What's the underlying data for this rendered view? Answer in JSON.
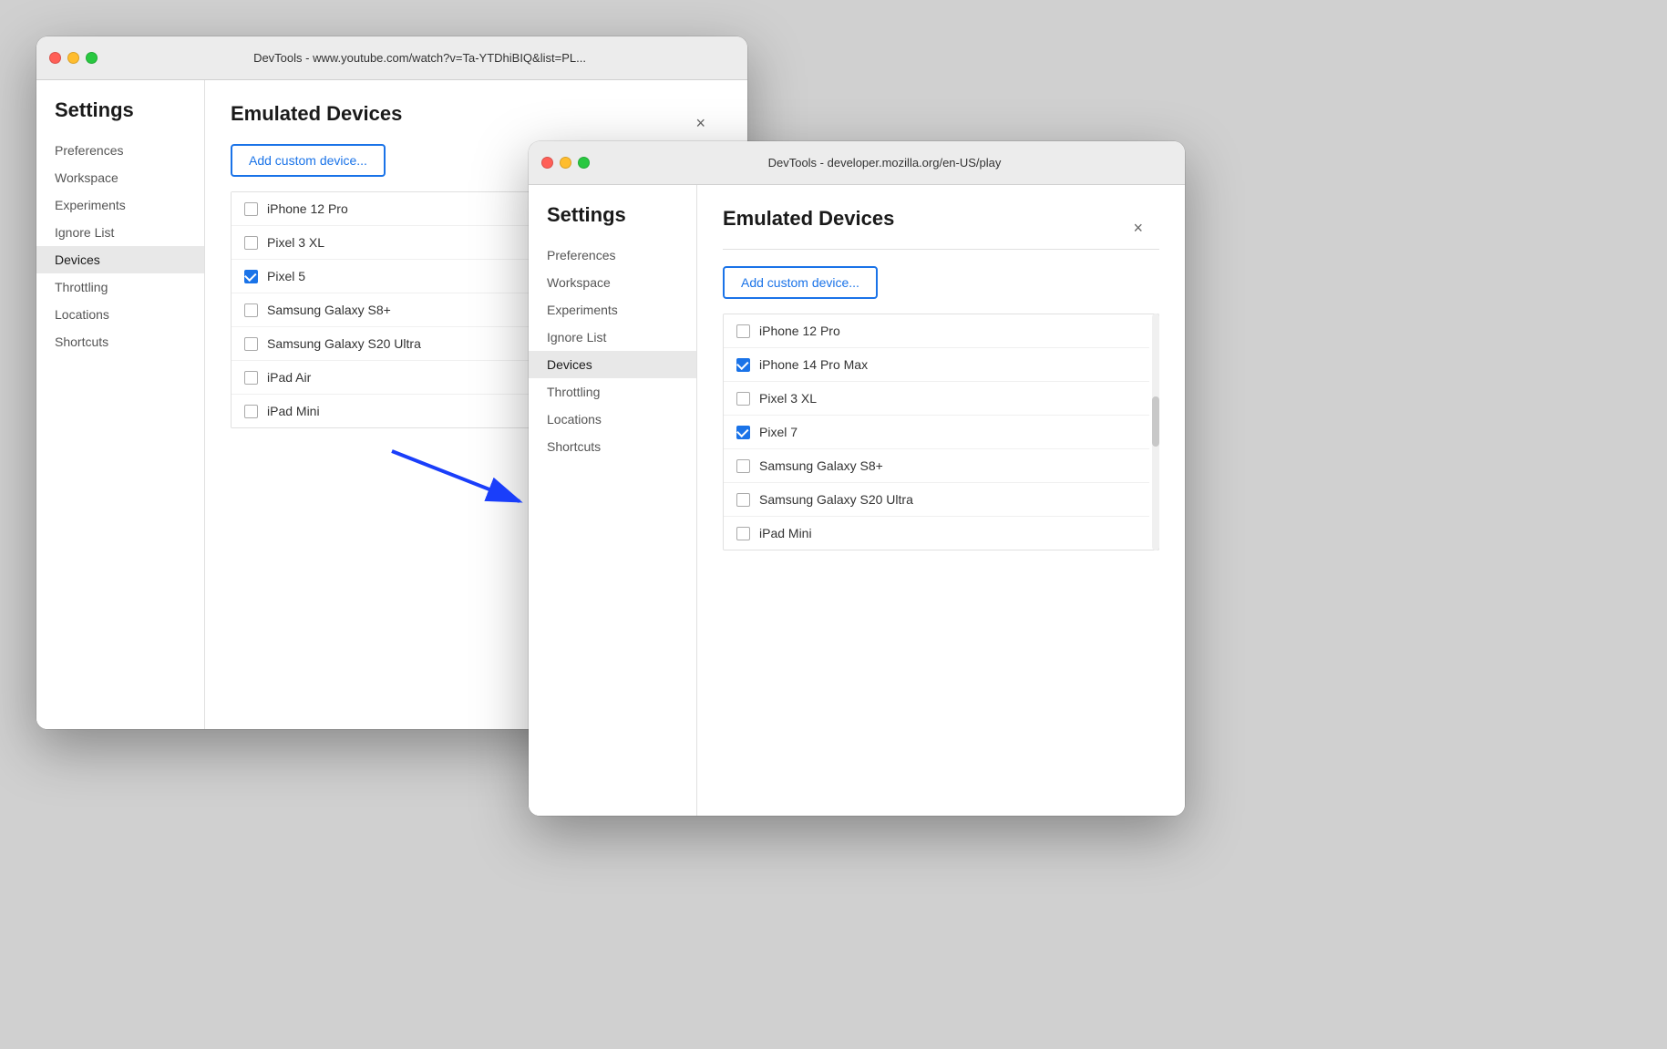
{
  "window_back": {
    "title": "DevTools - www.youtube.com/watch?v=Ta-YTDhiBIQ&list=PL...",
    "settings_heading": "Settings",
    "emulated_devices_heading": "Emulated Devices",
    "add_custom_label": "Add custom device...",
    "close_label": "×",
    "sidebar_items": [
      {
        "id": "preferences",
        "label": "Preferences",
        "active": false
      },
      {
        "id": "workspace",
        "label": "Workspace",
        "active": false
      },
      {
        "id": "experiments",
        "label": "Experiments",
        "active": false
      },
      {
        "id": "ignore-list",
        "label": "Ignore List",
        "active": false
      },
      {
        "id": "devices",
        "label": "Devices",
        "active": true
      },
      {
        "id": "throttling",
        "label": "Throttling",
        "active": false
      },
      {
        "id": "locations",
        "label": "Locations",
        "active": false
      },
      {
        "id": "shortcuts",
        "label": "Shortcuts",
        "active": false
      }
    ],
    "devices": [
      {
        "name": "iPhone 12 Pro",
        "checked": false
      },
      {
        "name": "Pixel 3 XL",
        "checked": false
      },
      {
        "name": "Pixel 5",
        "checked": true
      },
      {
        "name": "Samsung Galaxy S8+",
        "checked": false
      },
      {
        "name": "Samsung Galaxy S20 Ultra",
        "checked": false
      },
      {
        "name": "iPad Air",
        "checked": false
      },
      {
        "name": "iPad Mini",
        "checked": false
      }
    ]
  },
  "window_front": {
    "title": "DevTools - developer.mozilla.org/en-US/play",
    "settings_heading": "Settings",
    "emulated_devices_heading": "Emulated Devices",
    "add_custom_label": "Add custom device...",
    "close_label": "×",
    "sidebar_items": [
      {
        "id": "preferences",
        "label": "Preferences",
        "active": false
      },
      {
        "id": "workspace",
        "label": "Workspace",
        "active": false
      },
      {
        "id": "experiments",
        "label": "Experiments",
        "active": false
      },
      {
        "id": "ignore-list",
        "label": "Ignore List",
        "active": false
      },
      {
        "id": "devices",
        "label": "Devices",
        "active": true
      },
      {
        "id": "throttling",
        "label": "Throttling",
        "active": false
      },
      {
        "id": "locations",
        "label": "Locations",
        "active": false
      },
      {
        "id": "shortcuts",
        "label": "Shortcuts",
        "active": false
      }
    ],
    "devices": [
      {
        "name": "iPhone 12 Pro",
        "checked": false
      },
      {
        "name": "iPhone 14 Pro Max",
        "checked": true
      },
      {
        "name": "Pixel 3 XL",
        "checked": false
      },
      {
        "name": "Pixel 7",
        "checked": true
      },
      {
        "name": "Samsung Galaxy S8+",
        "checked": false
      },
      {
        "name": "Samsung Galaxy S20 Ultra",
        "checked": false
      },
      {
        "name": "iPad Mini",
        "checked": false
      }
    ]
  }
}
